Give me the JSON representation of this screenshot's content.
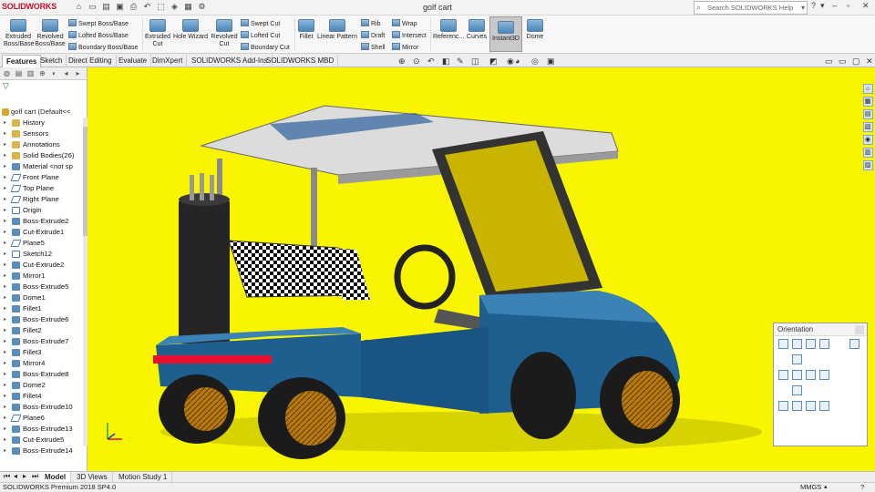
{
  "app": {
    "brand": "SOLIDWORKS",
    "document_title": "golf cart",
    "search_placeholder": "Search SOLIDWORKS Help"
  },
  "ribbon": {
    "buttons": [
      {
        "id": "extruded-boss",
        "label": "Extruded Boss/Base"
      },
      {
        "id": "revolved-boss",
        "label": "Revolved Boss/Base"
      },
      {
        "id": "extruded-cut",
        "label": "Extruded Cut"
      },
      {
        "id": "hole-wizard",
        "label": "Hole Wizard"
      },
      {
        "id": "revolved-cut",
        "label": "Revolved Cut"
      },
      {
        "id": "fillet",
        "label": "Fillet"
      },
      {
        "id": "linear-pattern",
        "label": "Linear Pattern"
      },
      {
        "id": "reference",
        "label": "Referenc..."
      },
      {
        "id": "curves",
        "label": "Curves"
      },
      {
        "id": "instant3d",
        "label": "Instant3D"
      },
      {
        "id": "dome",
        "label": "Dome"
      }
    ],
    "small": {
      "swept_boss": "Swept Boss/Base",
      "lofted_boss": "Lofted Boss/Base",
      "boundary_boss": "Boundary Boss/Base",
      "swept_cut": "Swept Cut",
      "lofted_cut": "Lofted Cut",
      "boundary_cut": "Boundary Cut",
      "rib": "Rib",
      "draft": "Draft",
      "shell": "Shell",
      "wrap": "Wrap",
      "intersect": "Intersect",
      "mirror": "Mirror"
    }
  },
  "tabs": [
    "Features",
    "Sketch",
    "Direct Editing",
    "Evaluate",
    "DimXpert",
    "SOLIDWORKS Add-Ins",
    "SOLIDWORKS MBD"
  ],
  "tree": {
    "root": "golf cart  (Default<<",
    "items": [
      {
        "label": "History",
        "icon": "folder"
      },
      {
        "label": "Sensors",
        "icon": "folder"
      },
      {
        "label": "Annotations",
        "icon": "folder"
      },
      {
        "label": "Solid Bodies(26)",
        "icon": "folder"
      },
      {
        "label": "Material <not sp",
        "icon": "feature"
      },
      {
        "label": "Front Plane",
        "icon": "plane"
      },
      {
        "label": "Top Plane",
        "icon": "plane"
      },
      {
        "label": "Right Plane",
        "icon": "plane"
      },
      {
        "label": "Origin",
        "icon": "sketch"
      },
      {
        "label": "Boss-Extrude2",
        "icon": "feature"
      },
      {
        "label": "Cut-Extrude1",
        "icon": "feature"
      },
      {
        "label": "Plane5",
        "icon": "plane"
      },
      {
        "label": "Sketch12",
        "icon": "sketch"
      },
      {
        "label": "Cut-Extrude2",
        "icon": "feature"
      },
      {
        "label": "Mirror1",
        "icon": "feature"
      },
      {
        "label": "Boss-Extrude5",
        "icon": "feature"
      },
      {
        "label": "Dome1",
        "icon": "feature"
      },
      {
        "label": "Fillet1",
        "icon": "feature"
      },
      {
        "label": "Boss-Extrude6",
        "icon": "feature"
      },
      {
        "label": "Fillet2",
        "icon": "feature"
      },
      {
        "label": "Boss-Extrude7",
        "icon": "feature"
      },
      {
        "label": "Fillet3",
        "icon": "feature"
      },
      {
        "label": "Mirror4",
        "icon": "feature"
      },
      {
        "label": "Boss-Extrude8",
        "icon": "feature"
      },
      {
        "label": "Dome2",
        "icon": "feature"
      },
      {
        "label": "Fillet4",
        "icon": "feature"
      },
      {
        "label": "Boss-Extrude10",
        "icon": "feature"
      },
      {
        "label": "Plane6",
        "icon": "plane"
      },
      {
        "label": "Boss-Extrude13",
        "icon": "feature"
      },
      {
        "label": "Cut-Extrude5",
        "icon": "feature"
      },
      {
        "label": "Boss-Extrude14",
        "icon": "feature"
      }
    ]
  },
  "bottom_tabs": [
    "Model",
    "3D Views",
    "Motion Study 1"
  ],
  "status": {
    "left": "SOLIDWORKS Premium 2018 SP4.0",
    "units": "MMGS"
  },
  "orientation": {
    "title": "Orientation"
  },
  "colors": {
    "viewport_bg": "#f9f500",
    "body_blue": "#1f5f8f",
    "stripe_red": "#e8102a"
  }
}
